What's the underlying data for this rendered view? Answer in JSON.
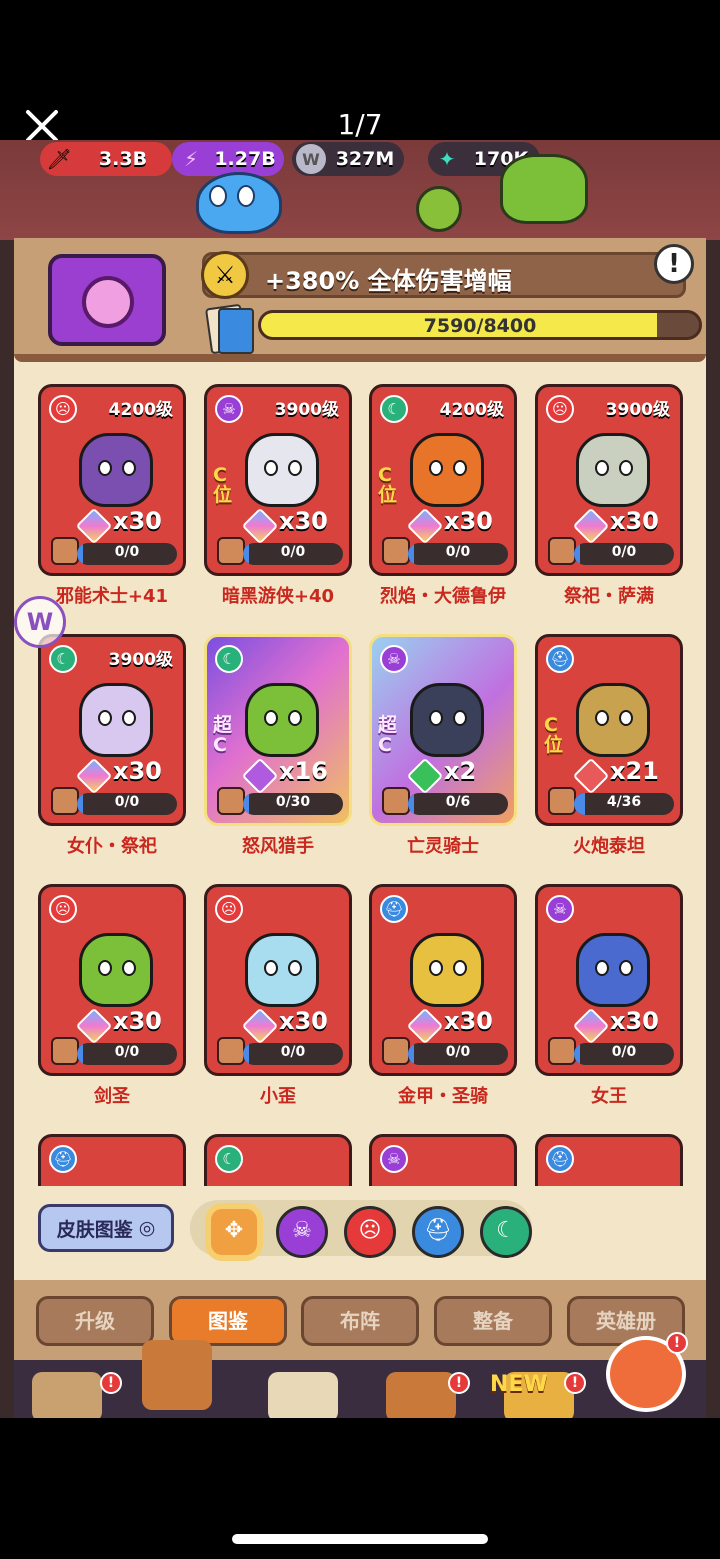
{
  "viewer": {
    "page_counter": "1/7"
  },
  "resources": [
    {
      "value": "3.3B",
      "icon": "sword-icon"
    },
    {
      "value": "1.27B",
      "icon": "lightning-icon"
    },
    {
      "value": "327M",
      "icon": "w-coin-icon",
      "icon_text": "W"
    },
    {
      "value": "170K",
      "icon": "gem-icon"
    }
  ],
  "bonus": {
    "text": "+380% 全体伤害增幅",
    "info_label": "!"
  },
  "collection": {
    "current": 7590,
    "max": 8400,
    "text": "7590/8400",
    "fraction": 0.9036
  },
  "heroes": [
    {
      "name": "邪能术士+41",
      "level": "4200级",
      "faction": "skull-red",
      "count": "x30",
      "progress": "0/0",
      "fraction": 0,
      "cpos": "",
      "art": "#7a4fb0",
      "shard": "rainbow"
    },
    {
      "name": "暗黑游侠+40",
      "level": "3900级",
      "faction": "skull-purple",
      "count": "x30",
      "progress": "0/0",
      "fraction": 0,
      "cpos": "C位",
      "art": "#e6e6ee",
      "shard": "rainbow"
    },
    {
      "name": "烈焰・大德鲁伊",
      "level": "4200级",
      "faction": "moon-green",
      "count": "x30",
      "progress": "0/0",
      "fraction": 0,
      "cpos": "C位",
      "art": "#e8742a",
      "shard": "rainbow"
    },
    {
      "name": "祭祀・萨满",
      "level": "3900级",
      "faction": "skull-red",
      "count": "x30",
      "progress": "0/0",
      "fraction": 0,
      "cpos": "",
      "art": "#c9d0c0",
      "shard": "rainbow"
    },
    {
      "name": "女仆・祭祀",
      "level": "3900级",
      "faction": "moon-green",
      "count": "x30",
      "progress": "0/0",
      "fraction": 0,
      "cpos": "",
      "art": "#d8c8f0",
      "shard": "rainbow"
    },
    {
      "name": "怒风猎手",
      "level": "",
      "faction": "moon-green",
      "count": "x16",
      "progress": "0/30",
      "fraction": 0,
      "cpos": "超C",
      "art": "#7cc03a",
      "shard": "purple",
      "frame": "super"
    },
    {
      "name": "亡灵骑士",
      "level": "",
      "faction": "skull-purple",
      "count": "x2",
      "progress": "0/6",
      "fraction": 0,
      "cpos": "超C",
      "art": "#3a3f5a",
      "shard": "green",
      "frame": "super2"
    },
    {
      "name": "火炮泰坦",
      "level": "",
      "faction": "helmet-blue",
      "count": "x21",
      "progress": "4/36",
      "fraction": 0.111,
      "cpos": "C位",
      "art": "#c9a250",
      "shard": "red"
    },
    {
      "name": "剑圣",
      "level": "",
      "faction": "skull-red",
      "count": "x30",
      "progress": "0/0",
      "fraction": 0,
      "cpos": "",
      "art": "#7cc03a",
      "shard": "rainbow"
    },
    {
      "name": "小歪",
      "level": "",
      "faction": "skull-red",
      "count": "x30",
      "progress": "0/0",
      "fraction": 0,
      "cpos": "",
      "art": "#a8dcef",
      "shard": "rainbow"
    },
    {
      "name": "金甲・圣骑",
      "level": "",
      "faction": "helmet-blue",
      "count": "x30",
      "progress": "0/0",
      "fraction": 0,
      "cpos": "",
      "art": "#e8c040",
      "shard": "rainbow"
    },
    {
      "name": "女王",
      "level": "",
      "faction": "skull-purple",
      "count": "x30",
      "progress": "0/0",
      "fraction": 0,
      "cpos": "",
      "art": "#4a6ad0",
      "shard": "rainbow"
    }
  ],
  "partial_row_factions": [
    "helmet-blue",
    "moon-green",
    "skull-purple",
    "helmet-blue"
  ],
  "filter": {
    "skin_button": "皮肤图鉴",
    "buttons": [
      {
        "name": "filter-all-button",
        "icon": "grid-icon",
        "glyph": "✥",
        "color": "#f0a040"
      },
      {
        "name": "filter-skull-purple-button",
        "icon": "skull-icon",
        "glyph": "☠",
        "color": "#9a3fd6"
      },
      {
        "name": "filter-skull-red-button",
        "icon": "angry-face-icon",
        "glyph": "☹",
        "color": "#e63a3a"
      },
      {
        "name": "filter-helmet-blue-button",
        "icon": "helmet-icon",
        "glyph": "⛑",
        "color": "#3a8ae0"
      },
      {
        "name": "filter-moon-green-button",
        "icon": "moon-icon",
        "glyph": "☾",
        "color": "#2ab07a"
      }
    ]
  },
  "tabs": [
    {
      "label": "升级",
      "active": false
    },
    {
      "label": "图鉴",
      "active": true
    },
    {
      "label": "布阵",
      "active": false
    },
    {
      "label": "整备",
      "active": false
    },
    {
      "label": "英雄册",
      "active": false
    }
  ],
  "nav": {
    "new_label": "NEW",
    "alert": "!"
  },
  "colors": {
    "card_red": "#d9433d",
    "panel_tan": "#c79f76",
    "cream": "#f3e6c8",
    "accent_orange": "#e87c2a",
    "progress_yellow": "#f5e84a"
  }
}
